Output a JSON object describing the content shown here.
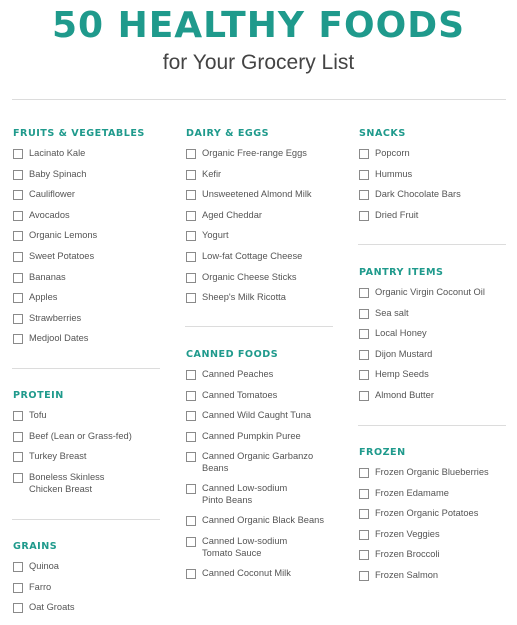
{
  "header": {
    "title": "50 HEALTHY FOODS",
    "subtitle": "for Your Grocery List"
  },
  "colors": {
    "accent": "#1f9a8c",
    "text": "#555555",
    "rule": "#dcdcdc"
  },
  "sections": {
    "fruits_vegetables": {
      "heading": "FRUITS & VEGETABLES",
      "items": [
        "Lacinato Kale",
        "Baby Spinach",
        "Cauliflower",
        "Avocados",
        "Organic Lemons",
        "Sweet Potatoes",
        "Bananas",
        "Apples",
        "Strawberries",
        "Medjool Dates"
      ]
    },
    "protein": {
      "heading": "PROTEIN",
      "items": [
        "Tofu",
        "Beef (Lean or Grass-fed)",
        "Turkey Breast"
      ],
      "wrap_item": {
        "line1": "Boneless Skinless",
        "line2": "Chicken Breast"
      }
    },
    "grains": {
      "heading": "GRAINS",
      "items": [
        "Quinoa",
        "Farro",
        "Oat Groats"
      ]
    },
    "dairy_eggs": {
      "heading": "DAIRY & EGGS",
      "items": [
        "Organic Free-range Eggs",
        "Kefir",
        "Unsweetened Almond Milk",
        "Aged Cheddar",
        "Yogurt",
        "Low-fat Cottage Cheese",
        "Organic Cheese Sticks",
        "Sheep's Milk Ricotta"
      ]
    },
    "canned_foods": {
      "heading": "CANNED FOODS",
      "items": [
        "Canned Peaches",
        "Canned Tomatoes",
        "Canned Wild Caught Tuna",
        "Canned Pumpkin Puree"
      ],
      "wrap_garbanzo": {
        "line1": "Canned Organic Garbanzo",
        "line2": "Beans"
      },
      "wrap_pinto": {
        "line1": "Canned Low-sodium",
        "line2": "Pinto Beans"
      },
      "black_beans": "Canned Organic Black Beans",
      "wrap_tomato_sauce": {
        "line1": "Canned Low-sodium",
        "line2": "Tomato Sauce"
      },
      "coconut_milk": "Canned Coconut Milk"
    },
    "snacks": {
      "heading": "SNACKS",
      "items": [
        "Popcorn",
        "Hummus",
        "Dark Chocolate Bars",
        "Dried Fruit"
      ]
    },
    "pantry_items": {
      "heading": "PANTRY ITEMS",
      "items": [
        "Organic Virgin Coconut Oil",
        "Sea salt",
        "Local Honey",
        "Dijon Mustard",
        "Hemp Seeds",
        "Almond Butter"
      ]
    },
    "frozen": {
      "heading": "FROZEN",
      "items": [
        "Frozen Organic Blueberries",
        "Frozen Edamame",
        "Frozen Organic Potatoes",
        "Frozen Veggies",
        "Frozen Broccoli",
        "Frozen Salmon"
      ]
    }
  }
}
